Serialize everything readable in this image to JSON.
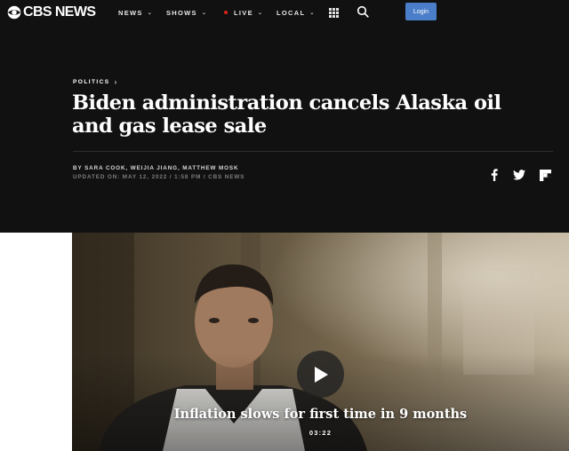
{
  "header": {
    "logo_text": "CBS NEWS",
    "nav": [
      {
        "label": "NEWS",
        "icon": "chevron-down-icon"
      },
      {
        "label": "SHOWS",
        "icon": "chevron-down-icon"
      },
      {
        "label": "LIVE",
        "icon": "chevron-down-icon",
        "live_dot_color": "#d9241c"
      },
      {
        "label": "LOCAL",
        "icon": "chevron-down-icon"
      }
    ],
    "apps_icon": "apps-grid-icon",
    "search_icon": "search-icon",
    "login_label": "Login",
    "login_color": "#4a7ec9"
  },
  "article": {
    "category": "POLITICS",
    "headline": "Biden administration cancels Alaska oil and gas lease sale",
    "byline": "BY SARA COOK, WEIJIA JIANG, MATTHEW MOSK",
    "updated": "UPDATED ON: MAY 12, 2022 / 1:58 PM / CBS NEWS",
    "share_icons": [
      "facebook-icon",
      "twitter-icon",
      "flipboard-icon"
    ]
  },
  "video": {
    "title": "Inflation slows for first time in 9 months",
    "duration": "03:22",
    "play_icon": "play-icon"
  }
}
